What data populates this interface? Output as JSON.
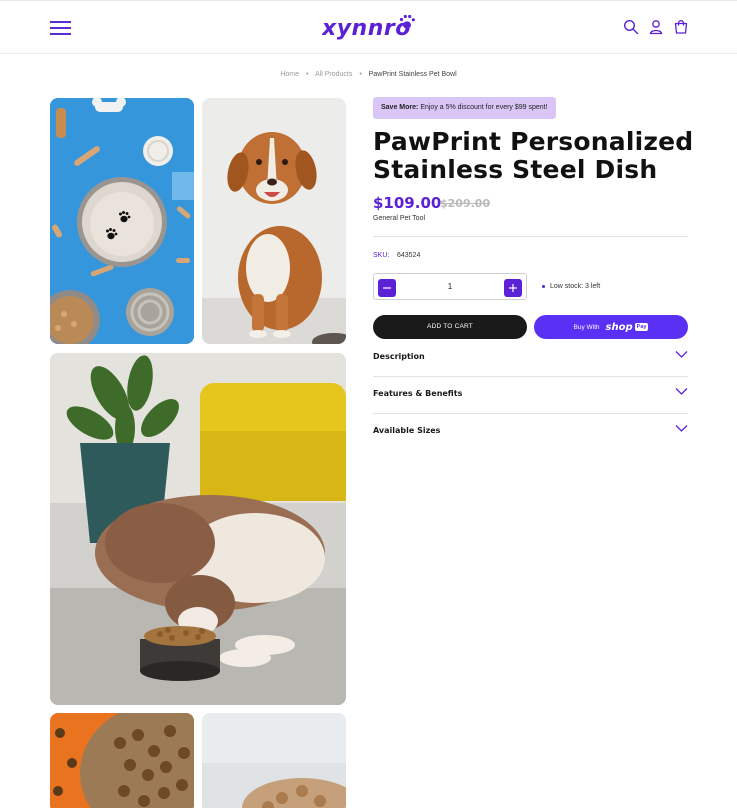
{
  "brand": {
    "logo_text": "xynnro",
    "accent": "#5b21d6"
  },
  "header": {
    "icons": [
      "menu-icon",
      "search-icon",
      "account-icon",
      "cart-icon"
    ]
  },
  "breadcrumb": {
    "items": [
      "Home",
      "All Products",
      "PawPrint Stainless Pet Bowl"
    ]
  },
  "gallery": {
    "images": [
      "bowl-on-blue-with-treats",
      "brown-dog-sitting",
      "dog-eating-from-bowl",
      "kibble-orange-bowl",
      "kibble-closeup"
    ]
  },
  "product": {
    "promo_bold": "Save More:",
    "promo_text": "Enjoy a 5% discount for every $99 spent!",
    "title_line1": "PawPrint Personalized",
    "title_line2": "Stainless Steel Dish",
    "price": "$109.00",
    "compare_price": "$209.00",
    "vendor": "General Pet Tool",
    "sku_label": "SKU:",
    "sku_value": "643524",
    "quantity": "1",
    "stock_text": "Low stock: 3 left",
    "add_to_cart": "ADD TO CART",
    "buy_with": "Buy With",
    "shop_word": "shop",
    "pay_word": "Pay"
  },
  "accordions": [
    {
      "label": "Description"
    },
    {
      "label": "Features & Benefits"
    },
    {
      "label": "Available Sizes"
    }
  ]
}
